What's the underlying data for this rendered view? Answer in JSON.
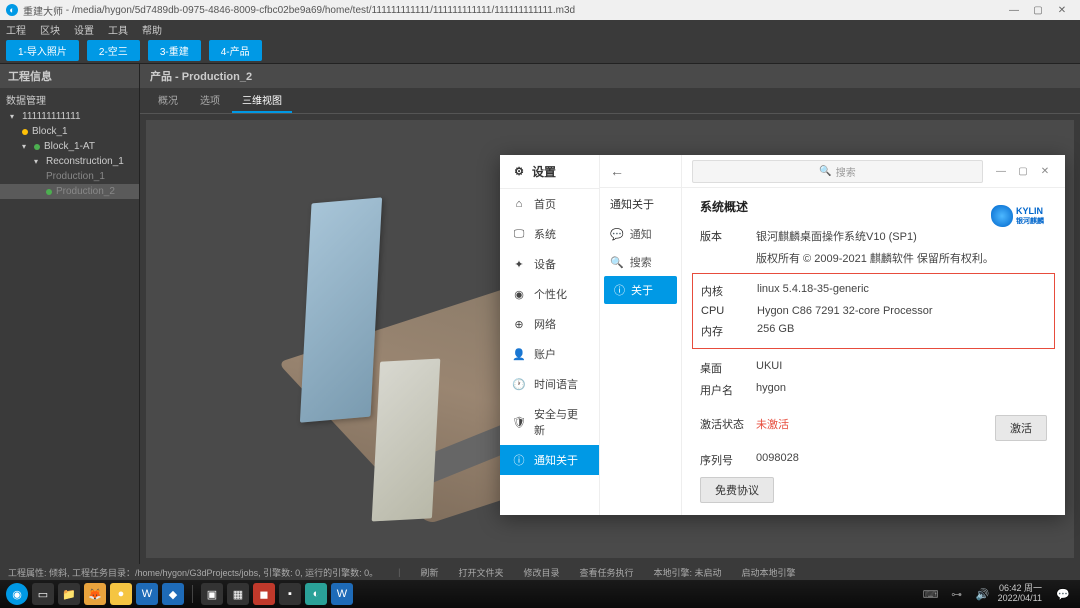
{
  "titlebar": {
    "app": "重建大师",
    "path": "/media/hygon/5d7489db-0975-4846-8009-cfbc02be9a69/home/test/111111111111/111111111111/111111111111.m3d"
  },
  "menu": {
    "items": [
      "工程",
      "区块",
      "设置",
      "工具",
      "帮助"
    ]
  },
  "steps": {
    "items": [
      "1-导入照片",
      "2-空三",
      "3-重建",
      "4-产品"
    ]
  },
  "sidebar": {
    "title": "工程信息",
    "root": "数据管理",
    "items": [
      "111111111111",
      "Block_1",
      "Block_1-AT",
      "Reconstruction_1",
      "Production_1",
      "Production_2"
    ]
  },
  "content": {
    "title": "产品 - Production_2",
    "tabs": [
      "概况",
      "选项",
      "三维视图"
    ]
  },
  "dialog": {
    "title": "设置",
    "nav": [
      "首页",
      "系统",
      "设备",
      "个性化",
      "网络",
      "账户",
      "时间语言",
      "安全与更新",
      "通知关于"
    ],
    "subhead_back": "←",
    "sub_title": "通知关于",
    "sub": {
      "notify": "通知",
      "search": "搜索",
      "about": "关于"
    },
    "search_placeholder": "搜索",
    "overview_title": "系统概述",
    "rows": {
      "version_l": "版本",
      "version_v": "银河麒麟桌面操作系统V10 (SP1)",
      "copyright": "版权所有 © 2009-2021 麒麟软件 保留所有权利。",
      "kernel_l": "内核",
      "kernel_v": "linux 5.4.18-35-generic",
      "cpu_l": "CPU",
      "cpu_v": "Hygon C86 7291 32-core Processor",
      "mem_l": "内存",
      "mem_v": "256 GB",
      "desktop_l": "桌面",
      "desktop_v": "UKUI",
      "user_l": "用户名",
      "user_v": "hygon",
      "act_l": "激活状态",
      "act_v": "未激活",
      "serial_l": "序列号",
      "serial_v": "0098028"
    },
    "activate_btn": "激活",
    "free_btn": "免费协议",
    "logo": "KYLIN",
    "logo_sub": "银河麒麟"
  },
  "status": {
    "left": "工程属性: 倾斜, 工程任务目录：/home/hygon/G3dProjects/jobs, 引擎数: 0, 运行的引擎数: 0。",
    "items": [
      "刷新",
      "打开文件夹",
      "修改目录",
      "查看任务执行",
      "本地引擎: 未启动",
      "启动本地引擎"
    ]
  },
  "clock": {
    "time": "06:42 周一",
    "date": "2022/04/11"
  }
}
